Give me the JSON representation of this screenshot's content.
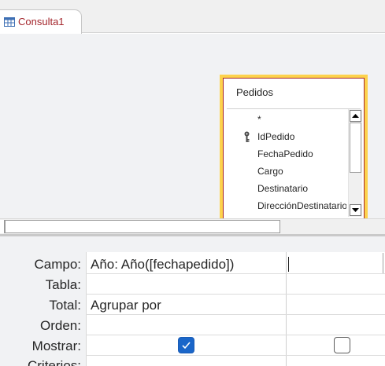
{
  "tab": {
    "title": "Consulta1",
    "icon": "query-icon"
  },
  "table_box": {
    "title": "Pedidos",
    "fields": [
      {
        "name": "*",
        "key": false
      },
      {
        "name": "IdPedido",
        "key": true
      },
      {
        "name": "FechaPedido",
        "key": false
      },
      {
        "name": "Cargo",
        "key": false
      },
      {
        "name": "Destinatario",
        "key": false
      },
      {
        "name": "DirecciónDestinatario",
        "key": false
      }
    ]
  },
  "grid": {
    "row_labels": {
      "campo": "Campo:",
      "tabla": "Tabla:",
      "total": "Total:",
      "orden": "Orden:",
      "mostrar": "Mostrar:",
      "criterios": "Criterios:"
    },
    "columns": [
      {
        "campo": "Año: Año([fechapedido])",
        "tabla": "",
        "total": "Agrupar por",
        "orden": "",
        "mostrar": true
      },
      {
        "campo": "",
        "tabla": "",
        "total": "",
        "orden": "",
        "mostrar": false
      }
    ]
  },
  "colors": {
    "accent": "#a4262c",
    "highlight": "#fdd24c",
    "checkbox": "#1a66c9"
  }
}
